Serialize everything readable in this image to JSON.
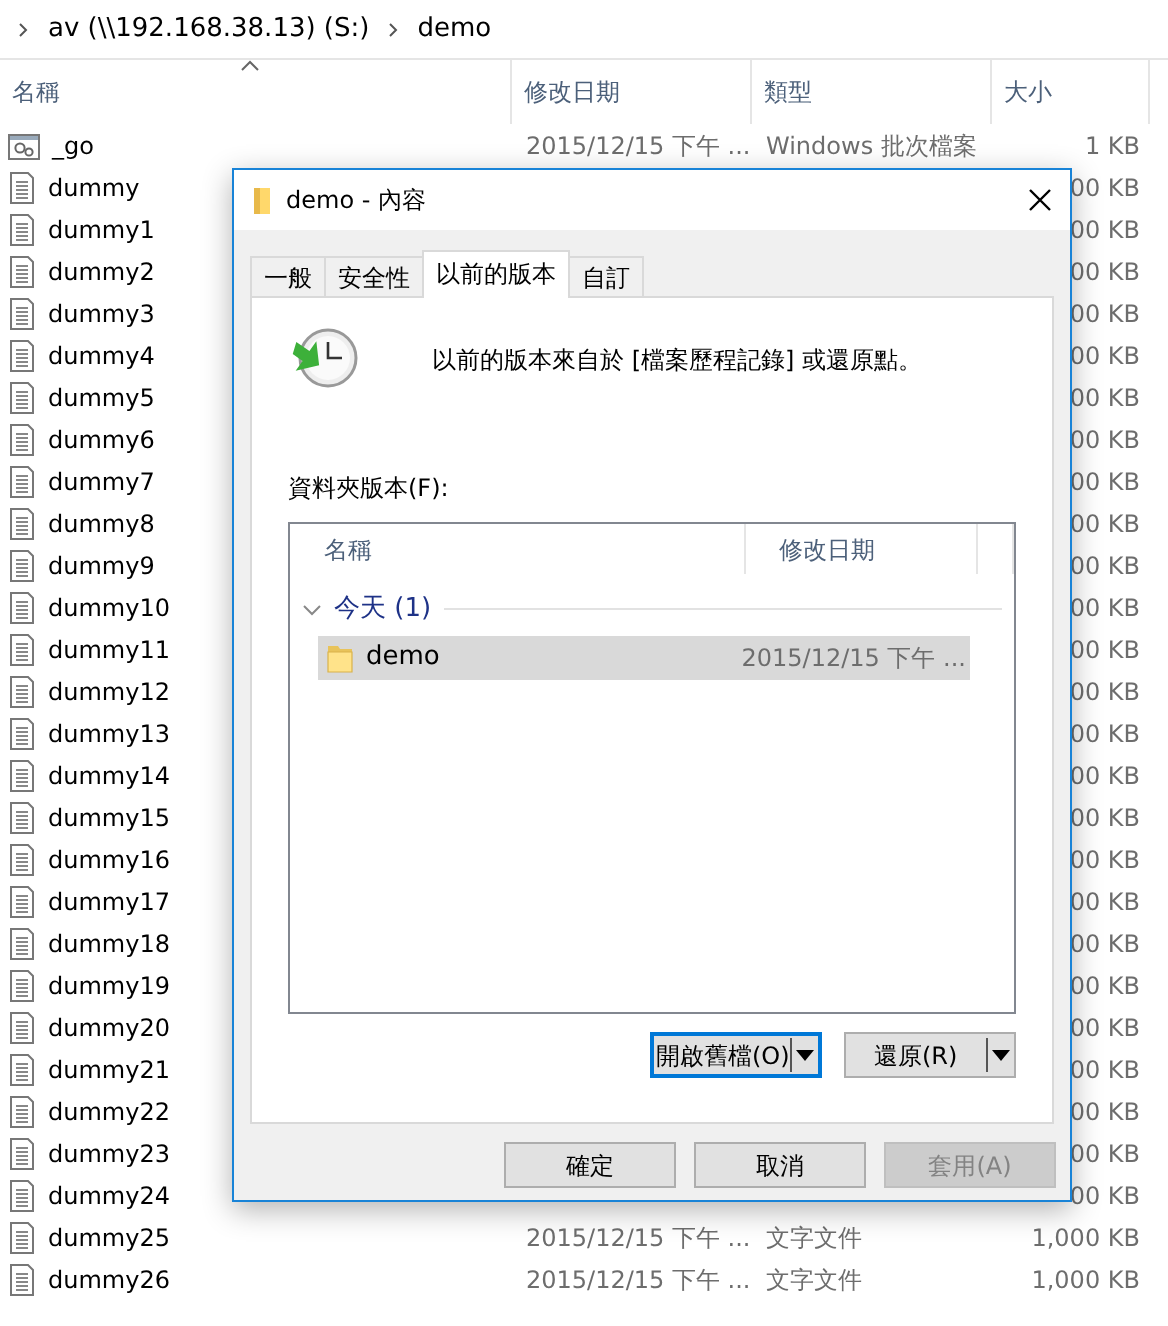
{
  "breadcrumb": [
    {
      "text": "av (\\\\192.168.38.13) (S:)"
    },
    {
      "text": "demo"
    }
  ],
  "columns": [
    {
      "label": "名稱",
      "sorted": true
    },
    {
      "label": "修改日期",
      "sorted": false
    },
    {
      "label": "類型",
      "sorted": false
    },
    {
      "label": "大小",
      "sorted": false
    }
  ],
  "files": [
    {
      "name": "_go",
      "kind": "batch",
      "date": "2015/12/15 下午 ...",
      "type": "Windows 批次檔案",
      "size": "1 KB"
    },
    {
      "name": "dummy",
      "kind": "text",
      "size": "00 KB"
    },
    {
      "name": "dummy1",
      "kind": "text",
      "size": "00 KB"
    },
    {
      "name": "dummy2",
      "kind": "text",
      "size": "00 KB"
    },
    {
      "name": "dummy3",
      "kind": "text",
      "size": "00 KB"
    },
    {
      "name": "dummy4",
      "kind": "text",
      "size": "00 KB"
    },
    {
      "name": "dummy5",
      "kind": "text",
      "size": "00 KB"
    },
    {
      "name": "dummy6",
      "kind": "text",
      "size": "00 KB"
    },
    {
      "name": "dummy7",
      "kind": "text",
      "size": "00 KB"
    },
    {
      "name": "dummy8",
      "kind": "text",
      "size": "00 KB"
    },
    {
      "name": "dummy9",
      "kind": "text",
      "size": "00 KB"
    },
    {
      "name": "dummy10",
      "kind": "text",
      "size": "00 KB"
    },
    {
      "name": "dummy11",
      "kind": "text",
      "size": "00 KB"
    },
    {
      "name": "dummy12",
      "kind": "text",
      "size": "00 KB"
    },
    {
      "name": "dummy13",
      "kind": "text",
      "size": "00 KB"
    },
    {
      "name": "dummy14",
      "kind": "text",
      "size": "00 KB"
    },
    {
      "name": "dummy15",
      "kind": "text",
      "size": "00 KB"
    },
    {
      "name": "dummy16",
      "kind": "text",
      "size": "00 KB"
    },
    {
      "name": "dummy17",
      "kind": "text",
      "size": "00 KB"
    },
    {
      "name": "dummy18",
      "kind": "text",
      "size": "00 KB"
    },
    {
      "name": "dummy19",
      "kind": "text",
      "size": "00 KB"
    },
    {
      "name": "dummy20",
      "kind": "text",
      "size": "00 KB"
    },
    {
      "name": "dummy21",
      "kind": "text",
      "size": "00 KB"
    },
    {
      "name": "dummy22",
      "kind": "text",
      "size": "00 KB"
    },
    {
      "name": "dummy23",
      "kind": "text",
      "size": "00 KB"
    },
    {
      "name": "dummy24",
      "kind": "text",
      "size": "00 KB"
    },
    {
      "name": "dummy25",
      "kind": "text",
      "date": "2015/12/15 下午 ...",
      "type": "文字文件",
      "size": "1,000 KB"
    },
    {
      "name": "dummy26",
      "kind": "text",
      "date": "2015/12/15 下午 ...",
      "type": "文字文件",
      "size": "1,000 KB"
    }
  ],
  "dialog": {
    "title": "demo - 內容",
    "tabs": [
      {
        "label": "一般",
        "selected": false
      },
      {
        "label": "安全性",
        "selected": false
      },
      {
        "label": "以前的版本",
        "selected": true
      },
      {
        "label": "自訂",
        "selected": false
      }
    ],
    "description": "以前的版本來自於 [檔案歷程記錄] 或還原點。",
    "versions_label": "資料夾版本(F):",
    "list_columns": [
      {
        "label": "名稱"
      },
      {
        "label": "修改日期"
      }
    ],
    "groups": [
      {
        "label": "今天 (1)",
        "expanded": true,
        "items": [
          {
            "name": "demo",
            "date": "2015/12/15 下午 ...",
            "selected": true
          }
        ]
      }
    ],
    "action_buttons": [
      {
        "label": "開啟舊檔(O)",
        "focused": true
      },
      {
        "label": "還原(R)",
        "focused": false
      }
    ],
    "footer_buttons": [
      {
        "label": "確定",
        "disabled": false
      },
      {
        "label": "取消",
        "disabled": false
      },
      {
        "label": "套用(A)",
        "disabled": true
      }
    ]
  }
}
